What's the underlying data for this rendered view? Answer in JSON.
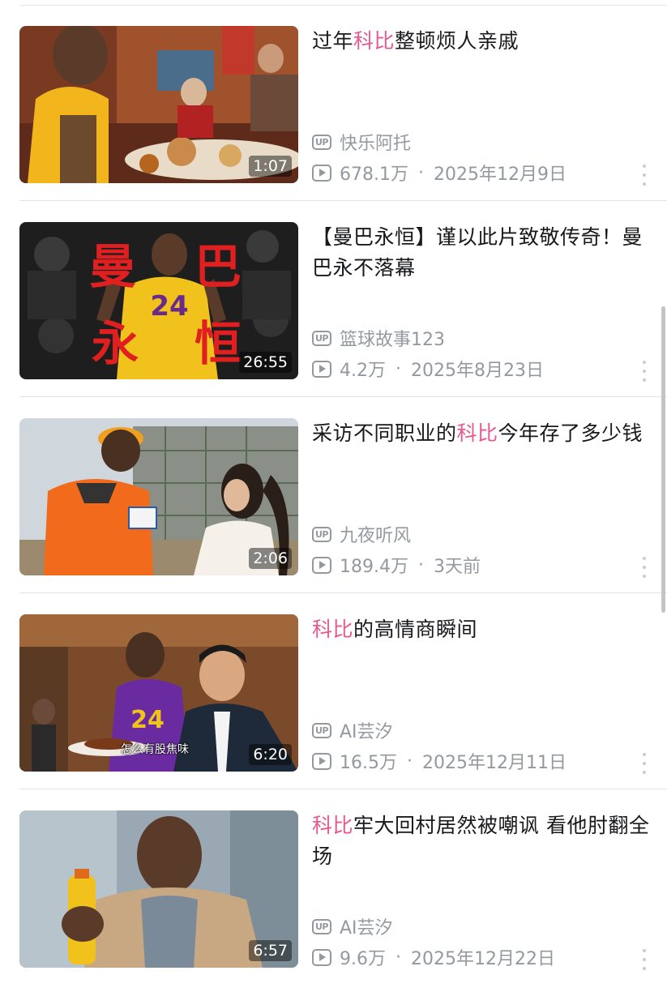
{
  "accent_color": "#e8598f",
  "muted_color": "#9499a0",
  "videos": [
    {
      "title_parts": [
        "过年",
        "科比",
        "整顿烦人亲戚"
      ],
      "highlight_index": 1,
      "duration": "1:07",
      "uploader": "快乐阿托",
      "views": "678.1万",
      "date": "2025年12月9日"
    },
    {
      "title_parts": [
        "【曼巴永恒】谨以此片致敬传奇！曼巴永不落幕"
      ],
      "highlight_index": -1,
      "duration": "26:55",
      "uploader": "篮球故事123",
      "views": "4.2万",
      "date": "2025年8月23日",
      "thumb_text": [
        "曼",
        "巴",
        "永",
        "恒"
      ],
      "jersey": "24"
    },
    {
      "title_parts": [
        "采访不同职业的",
        "科比",
        "今年存了多少钱"
      ],
      "highlight_index": 1,
      "duration": "2:06",
      "uploader": "九夜听风",
      "views": "189.4万",
      "date": "3天前"
    },
    {
      "title_parts": [
        "科比",
        "的高情商瞬间"
      ],
      "highlight_index": 0,
      "duration": "6:20",
      "uploader": "AI芸汐",
      "views": "16.5万",
      "date": "2025年12月11日",
      "thumb_subtitle": "怎么有股焦味",
      "jersey": "24"
    },
    {
      "title_parts": [
        "科比",
        "牢大回村居然被嘲讽 看他肘翻全场"
      ],
      "highlight_index": 0,
      "duration": "6:57",
      "uploader": "AI芸汐",
      "views": "9.6万",
      "date": "2025年12月22日"
    }
  ],
  "icons": {
    "uploader": "up-badge-icon",
    "views": "play-count-icon",
    "more": "more-vertical-icon"
  },
  "up_badge_text": "UP",
  "stat_separator": "·"
}
